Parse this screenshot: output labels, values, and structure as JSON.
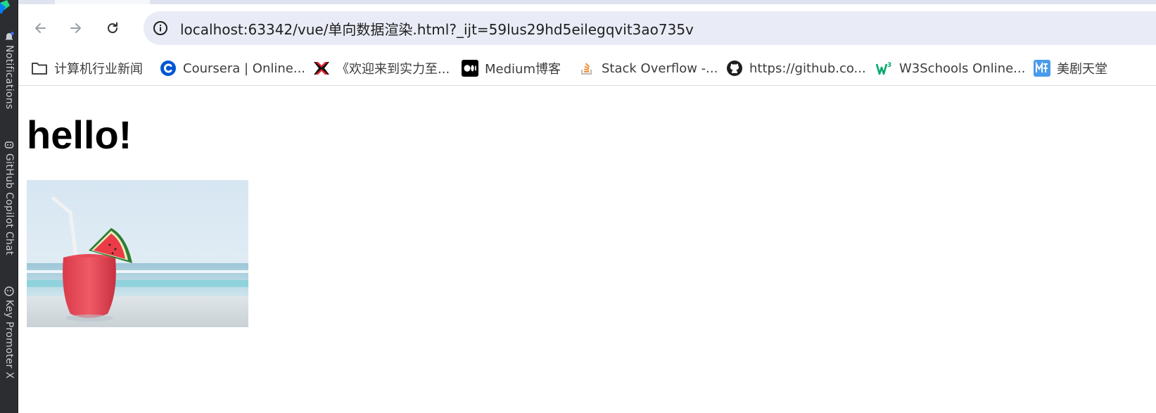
{
  "ide_sidebar": {
    "tools": [
      {
        "label": "Notifications",
        "icon": "bell-icon"
      },
      {
        "label": "GitHub Copilot Chat",
        "icon": "copilot-icon"
      },
      {
        "label": "Key Promoter X",
        "icon": "key-promoter-icon"
      }
    ]
  },
  "browser": {
    "url": "localhost:63342/vue/单向数据渲染.html?_ijt=59lus29hd5eilegqvit3ao735v",
    "nav": {
      "back_icon": "arrow-left-icon",
      "forward_icon": "arrow-right-icon",
      "reload_icon": "reload-icon",
      "site_info_icon": "info-icon"
    },
    "bookmarks": [
      {
        "label": "计算机行业新闻",
        "icon": "folder-icon"
      },
      {
        "label": "Coursera | Online...",
        "icon": "coursera-icon"
      },
      {
        "label": "《欢迎来到实力至...",
        "icon": "anime-logo-icon"
      },
      {
        "label": "Medium博客",
        "icon": "medium-icon"
      },
      {
        "label": "Stack Overflow -...",
        "icon": "stackoverflow-icon"
      },
      {
        "label": "https://github.co...",
        "icon": "github-icon"
      },
      {
        "label": "W3Schools Online...",
        "icon": "w3schools-icon"
      },
      {
        "label": "美剧天堂",
        "icon": "meiju-icon"
      }
    ]
  },
  "page": {
    "heading": "hello!",
    "image_subject": "watermelon-drink-photo"
  },
  "colors": {
    "ide_background": "#2b2d30",
    "tab_strip": "#dfe3f0",
    "omnibox": "#e9ecf6",
    "coursera_blue": "#0056d2",
    "w3schools_green": "#04aa6d",
    "stackoverflow_orange": "#f48024"
  }
}
